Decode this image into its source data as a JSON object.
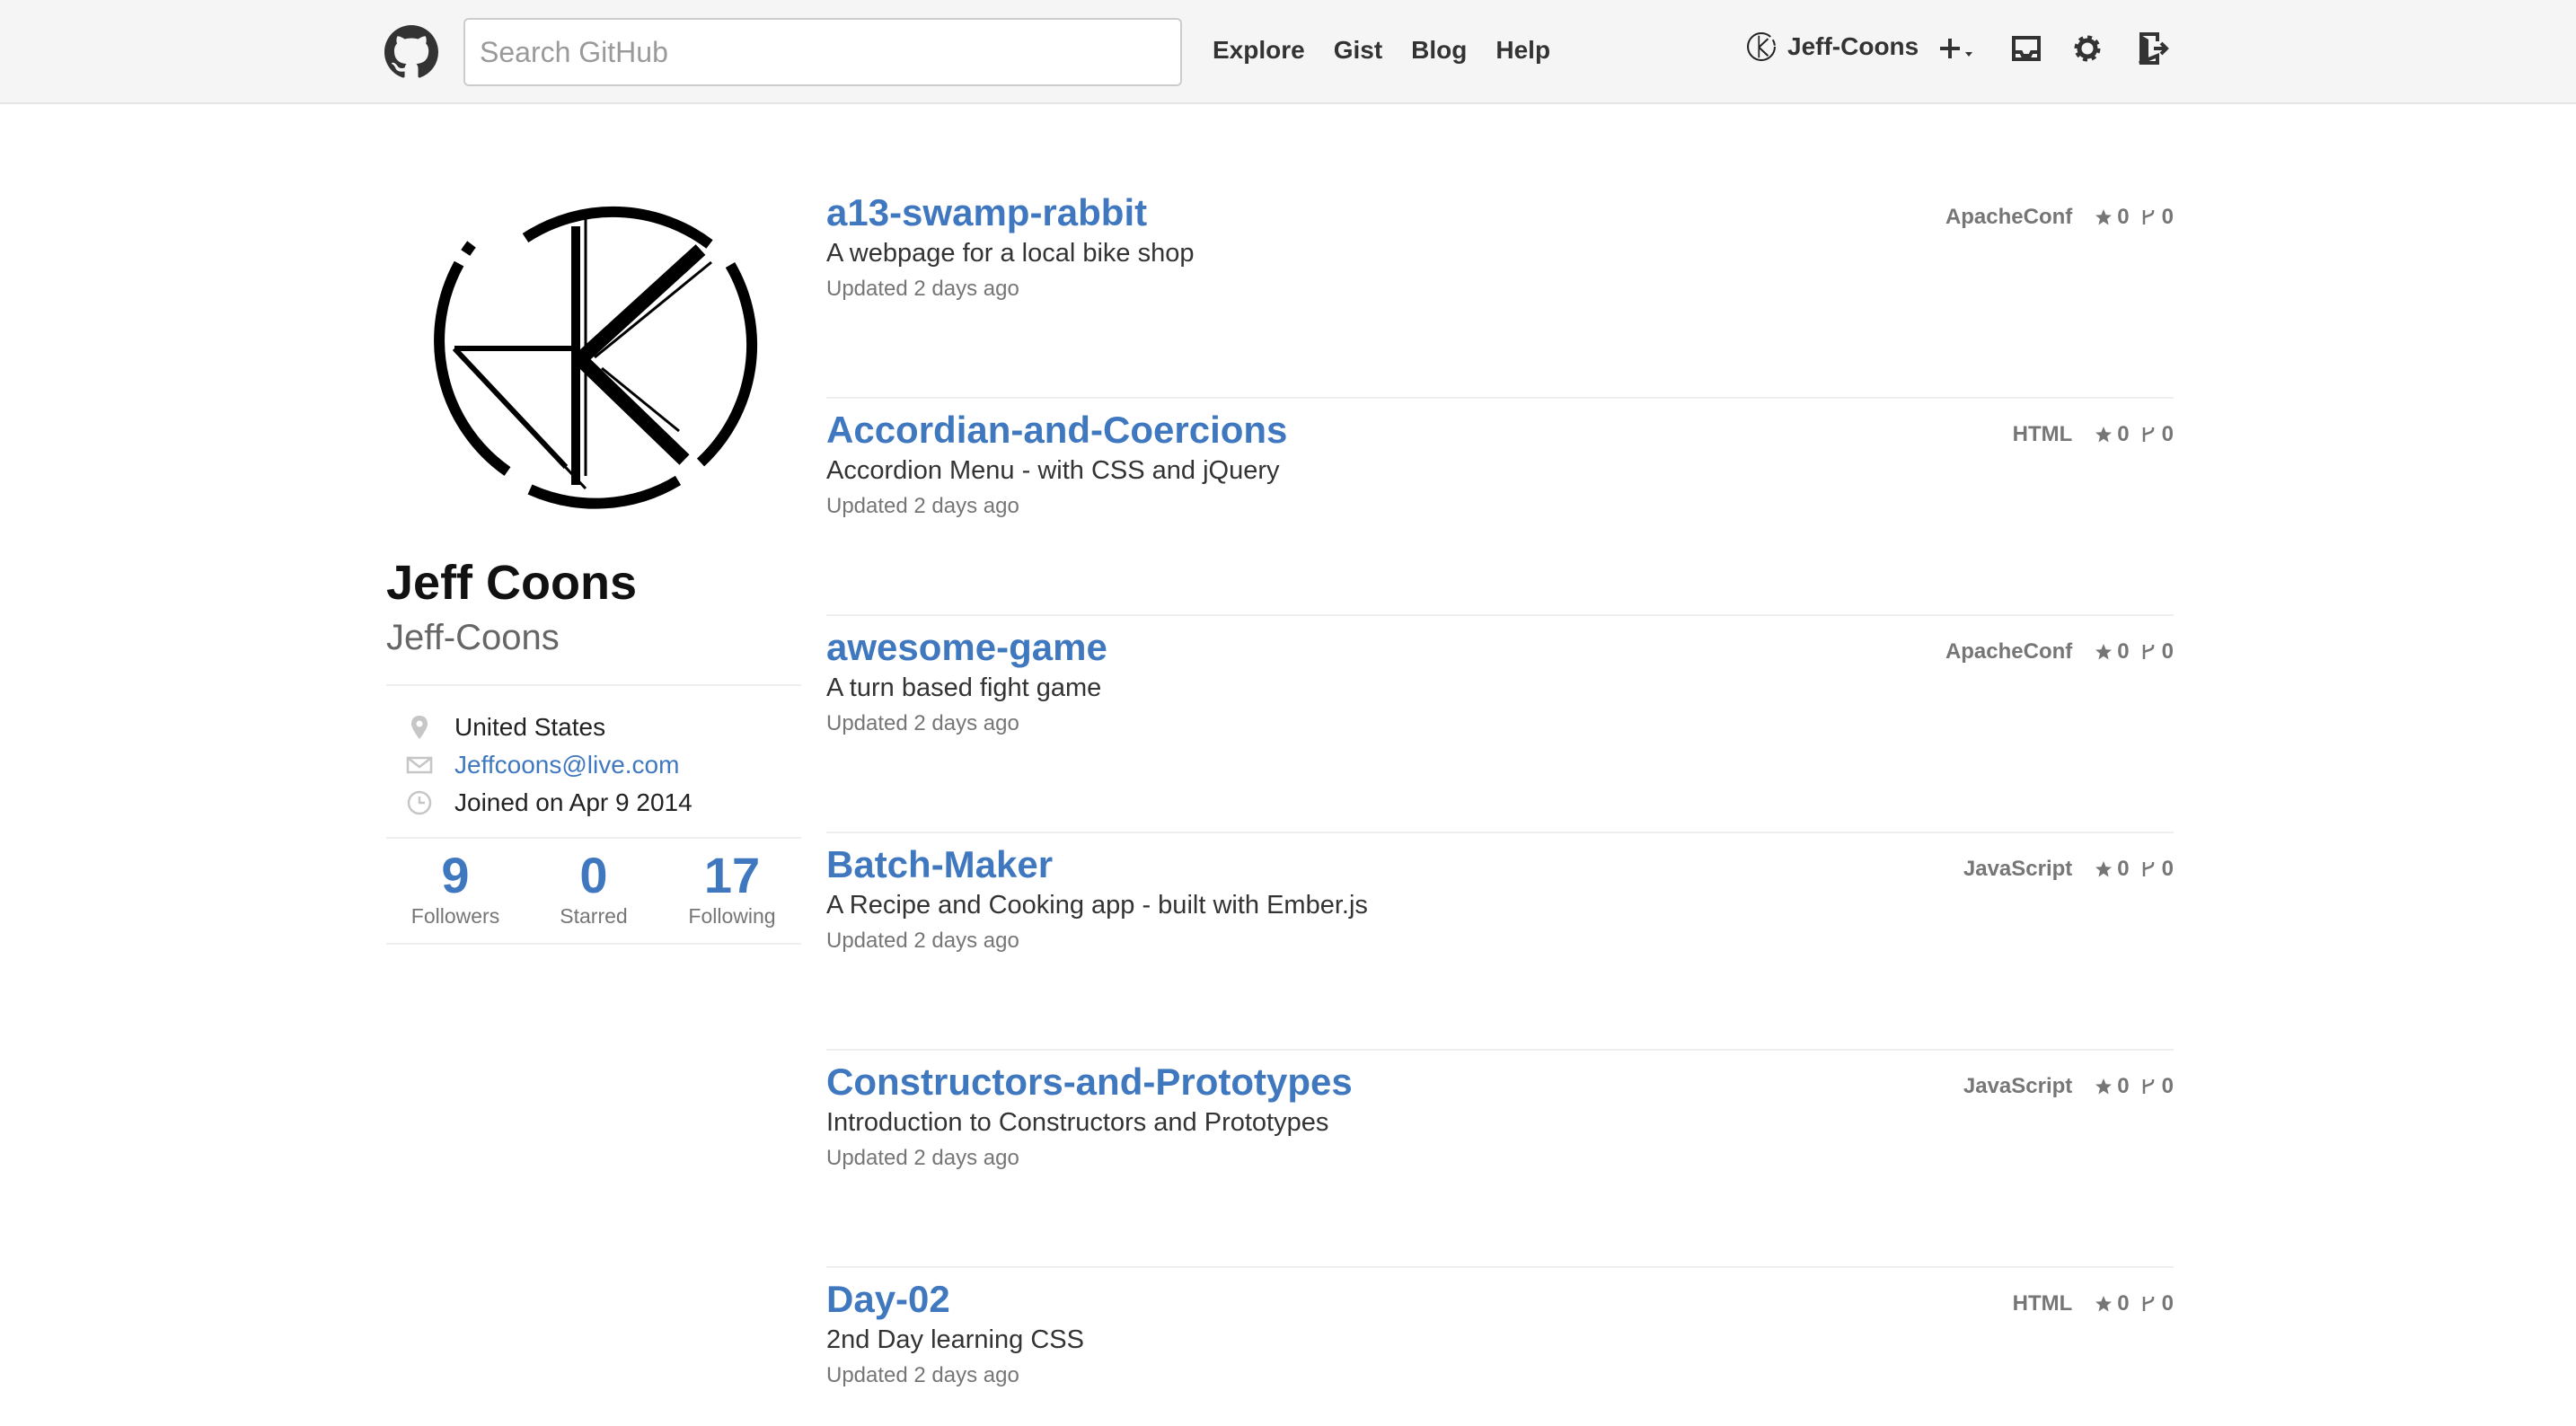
{
  "header": {
    "search_placeholder": "Search GitHub",
    "nav": [
      "Explore",
      "Gist",
      "Blog",
      "Help"
    ],
    "username": "Jeff-Coons",
    "icons": [
      "octocat-icon",
      "plus-icon",
      "inbox-icon",
      "gear-icon",
      "sign-out-icon"
    ]
  },
  "profile": {
    "fullname": "Jeff Coons",
    "username": "Jeff-Coons",
    "location": "United States",
    "email": "Jeffcoons@live.com",
    "joined": "Joined on Apr 9 2014",
    "stats": [
      {
        "value": "9",
        "label": "Followers"
      },
      {
        "value": "0",
        "label": "Starred"
      },
      {
        "value": "17",
        "label": "Following"
      }
    ]
  },
  "repos": [
    {
      "name": "a13-swamp-rabbit",
      "desc": "A webpage for a local bike shop",
      "updated": "Updated 2 days ago",
      "lang": "ApacheConf",
      "stars": "0",
      "forks": "0"
    },
    {
      "name": "Accordian-and-Coercions",
      "desc": "Accordion Menu - with CSS and jQuery",
      "updated": "Updated 2 days ago",
      "lang": "HTML",
      "stars": "0",
      "forks": "0"
    },
    {
      "name": "awesome-game",
      "desc": "A turn based fight game",
      "updated": "Updated 2 days ago",
      "lang": "ApacheConf",
      "stars": "0",
      "forks": "0"
    },
    {
      "name": "Batch-Maker",
      "desc": "A Recipe and Cooking app - built with Ember.js",
      "updated": "Updated 2 days ago",
      "lang": "JavaScript",
      "stars": "0",
      "forks": "0"
    },
    {
      "name": "Constructors-and-Prototypes",
      "desc": "Introduction to Constructors and Prototypes",
      "updated": "Updated 2 days ago",
      "lang": "JavaScript",
      "stars": "0",
      "forks": "0"
    },
    {
      "name": "Day-02",
      "desc": "2nd Day learning CSS",
      "updated": "Updated 2 days ago",
      "lang": "HTML",
      "stars": "0",
      "forks": "0"
    }
  ],
  "colors": {
    "link": "#4078c0",
    "muted": "#767676",
    "header_bg": "#f5f5f5"
  }
}
